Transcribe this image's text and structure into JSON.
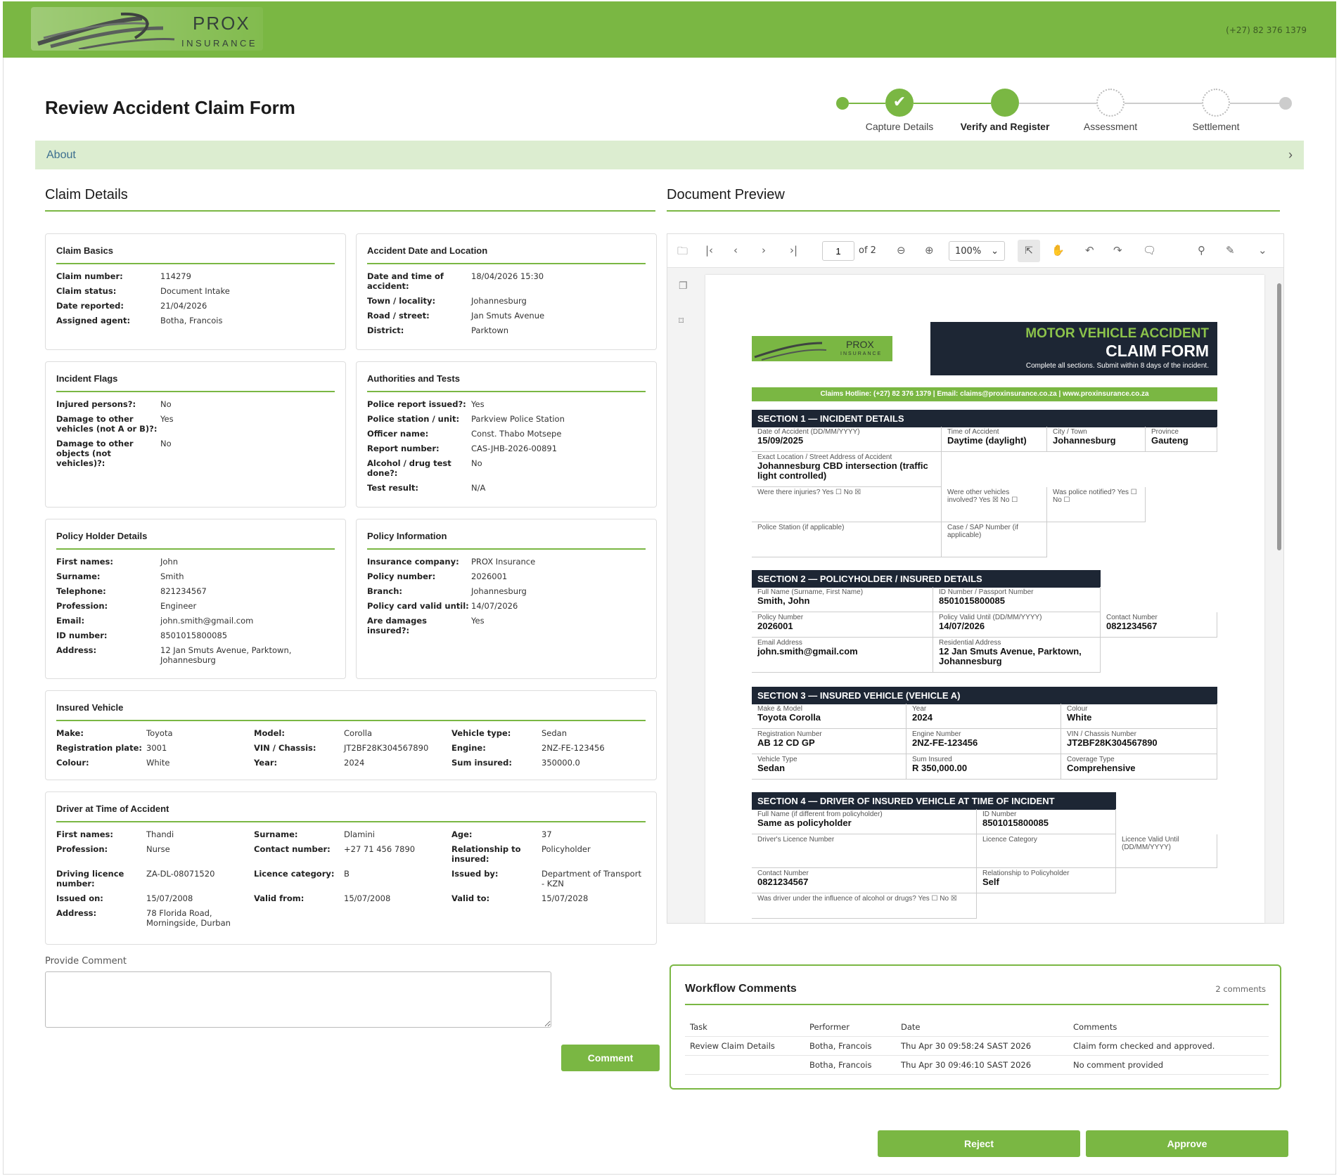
{
  "header": {
    "brand_top": "PROX",
    "brand_bottom": "INSURANCE",
    "phone": "(+27) 82 376 1379"
  },
  "page": {
    "title": "Review Accident Claim Form",
    "about": "About"
  },
  "stepper": {
    "steps": [
      "Capture Details",
      "Verify and Register",
      "Assessment",
      "Settlement"
    ]
  },
  "claim_details": {
    "title": "Claim Details"
  },
  "claim_basics": {
    "title": "Claim Basics",
    "rows": [
      [
        "Claim number:",
        "114279"
      ],
      [
        "Claim status:",
        "Document Intake"
      ],
      [
        "Date reported:",
        "21/04/2026"
      ],
      [
        "Assigned agent:",
        "Botha, Francois"
      ]
    ]
  },
  "accident_location": {
    "title": "Accident Date and Location",
    "rows": [
      [
        "Date and time of accident:",
        "18/04/2026 15:30"
      ],
      [
        "Town / locality:",
        "Johannesburg"
      ],
      [
        "Road / street:",
        "Jan Smuts Avenue"
      ],
      [
        "District:",
        "Parktown"
      ]
    ]
  },
  "incident_flags": {
    "title": "Incident Flags",
    "rows": [
      [
        "Injured persons?:",
        "No"
      ],
      [
        "Damage to other vehicles (not A or B)?:",
        "Yes"
      ],
      [
        "Damage to other objects (not vehicles)?:",
        "No"
      ]
    ]
  },
  "authorities": {
    "title": "Authorities and Tests",
    "rows": [
      [
        "Police report issued?:",
        "Yes"
      ],
      [
        "Police station / unit:",
        "Parkview Police Station"
      ],
      [
        "Officer name:",
        "Const. Thabo Motsepe"
      ],
      [
        "Report number:",
        "CAS-JHB-2026-00891"
      ],
      [
        "Alcohol / drug test done?:",
        "No"
      ],
      [
        "Test result:",
        "N/A"
      ]
    ]
  },
  "policy_holder": {
    "title": "Policy Holder Details",
    "rows": [
      [
        "First names:",
        "John"
      ],
      [
        "Surname:",
        "Smith"
      ],
      [
        "Telephone:",
        "821234567"
      ],
      [
        "Profession:",
        "Engineer"
      ],
      [
        "Email:",
        "john.smith@gmail.com"
      ],
      [
        "ID number:",
        "8501015800085"
      ],
      [
        "Address:",
        "12 Jan Smuts Avenue, Parktown, Johannesburg"
      ]
    ]
  },
  "policy_info": {
    "title": "Policy Information",
    "rows": [
      [
        "Insurance company:",
        "PROX Insurance"
      ],
      [
        "Policy number:",
        "2026001"
      ],
      [
        "Branch:",
        "Johannesburg"
      ],
      [
        "Policy card valid until:",
        "14/07/2026"
      ],
      [
        "Are damages insured?:",
        "Yes"
      ]
    ]
  },
  "insured_vehicle": {
    "title": "Insured Vehicle",
    "rows": [
      [
        "Make:",
        "Toyota",
        "Model:",
        "Corolla",
        "Vehicle type:",
        "Sedan"
      ],
      [
        "Registration plate:",
        "3001",
        "VIN / Chassis:",
        "JT2BF28K304567890",
        "Engine:",
        "2NZ-FE-123456"
      ],
      [
        "Colour:",
        "White",
        "Year:",
        "2024",
        "Sum insured:",
        "350000.0"
      ]
    ]
  },
  "driver": {
    "title": "Driver at Time of Accident",
    "rows": [
      [
        "First names:",
        "Thandi",
        "Surname:",
        "Dlamini",
        "Age:",
        "37"
      ],
      [
        "Profession:",
        "Nurse",
        "Contact number:",
        "+27 71 456 7890",
        "Relationship to insured:",
        "Policyholder"
      ],
      [
        "Driving licence number:",
        "ZA-DL-08071520",
        "Licence category:",
        "B",
        "Issued by:",
        "Department of Transport - KZN"
      ],
      [
        "Issued on:",
        "15/07/2008",
        "Valid from:",
        "15/07/2008",
        "Valid to:",
        "15/07/2028"
      ],
      [
        "Address:",
        "78 Florida Road, Morningside, Durban",
        "",
        "",
        "",
        ""
      ]
    ]
  },
  "comment": {
    "label": "Provide Comment",
    "button": "Comment"
  },
  "doc_preview": {
    "title": "Document Preview",
    "page_num": "1",
    "page_of": "of 2",
    "zoom": "100%"
  },
  "pdf": {
    "title1": "MOTOR VEHICLE ACCIDENT",
    "title2": "CLAIM FORM",
    "subtitle": "Complete all sections. Submit within 8 days of the incident.",
    "hotline": "Claims Hotline: (+27) 82 376 1379  |  Email: claims@proxinsurance.co.za  |  www.proxinsurance.co.za",
    "s1": "SECTION 1 — INCIDENT DETAILS",
    "s2": "SECTION 2 — POLICYHOLDER / INSURED DETAILS",
    "s3": "SECTION 3 — INSURED VEHICLE (VEHICLE A)",
    "s4": "SECTION 4 — DRIVER OF INSURED VEHICLE AT TIME OF INCIDENT",
    "f": {
      "date_l": "Date of Accident (DD/MM/YYYY)",
      "date_v": "15/09/2025",
      "time_l": "Time of Accident",
      "time_v": "Daytime (daylight)",
      "city_l": "City / Town",
      "city_v": "Johannesburg",
      "prov_l": "Province",
      "prov_v": "Gauteng",
      "loc_l": "Exact Location / Street Address of Accident",
      "loc_v": "Johannesburg CBD intersection (traffic light controlled)",
      "inj": "Were there injuries?  Yes ☐  No ☒",
      "oth": "Were other vehicles involved?  Yes ☒  No ☐",
      "pol": "Was police notified?  Yes ☐  No ☐",
      "ps_l": "Police Station (if applicable)",
      "case_l": "Case / SAP Number (if applicable)",
      "name_l": "Full Name (Surname, First Name)",
      "name_v": "Smith, John",
      "id_l": "ID Number / Passport Number",
      "id_v": "8501015800085",
      "pn_l": "Policy Number",
      "pn_v": "2026001",
      "pv_l": "Policy Valid Until (DD/MM/YYYY)",
      "pv_v": "14/07/2026",
      "cn_l": "Contact Number",
      "cn_v": "0821234567",
      "em_l": "Email Address",
      "em_v": "john.smith@gmail.com",
      "ra_l": "Residential Address",
      "ra_v": "12 Jan Smuts Avenue, Parktown, Johannesburg",
      "mm_l": "Make & Model",
      "mm_v": "Toyota Corolla",
      "yr_l": "Year",
      "yr_v": "2024",
      "col_l": "Colour",
      "col_v": "White",
      "reg_l": "Registration Number",
      "reg_v": "AB 12 CD GP",
      "eng_l": "Engine Number",
      "eng_v": "2NZ-FE-123456",
      "vin_l": "VIN / Chassis Number",
      "vin_v": "JT2BF28K304567890",
      "vt_l": "Vehicle Type",
      "vt_v": "Sedan",
      "si_l": "Sum Insured",
      "si_v": "R 350,000.00",
      "ct_l": "Coverage Type",
      "ct_v": "Comprehensive",
      "dn_l": "Full Name (if different from policyholder)",
      "dn_v": "Same as policyholder",
      "did_l": "ID Number",
      "did_v": "8501015800085",
      "dl_l": "Driver's Licence Number",
      "lc_l": "Licence Category",
      "lv_l": "Licence Valid Until (DD/MM/YYYY)",
      "dc_l": "Contact Number",
      "dc_v": "0821234567",
      "rp_l": "Relationship to Policyholder",
      "rp_v": "Self",
      "alc": "Was driver under the influence of alcohol or drugs?  Yes ☐  No ☒"
    }
  },
  "workflow": {
    "title": "Workflow Comments",
    "count": "2 comments",
    "headers": [
      "Task",
      "Performer",
      "Date",
      "Comments"
    ],
    "rows": [
      [
        "Review Claim Details",
        "Botha, Francois",
        "Thu Apr 30 09:58:24 SAST 2026",
        "Claim form checked and approved."
      ],
      [
        "",
        "Botha, Francois",
        "Thu Apr 30 09:46:10 SAST 2026",
        "No comment provided"
      ]
    ]
  },
  "actions": {
    "reject": "Reject",
    "approve": "Approve"
  },
  "colors": {
    "accent": "#7ab743",
    "dark": "#1d2634"
  }
}
